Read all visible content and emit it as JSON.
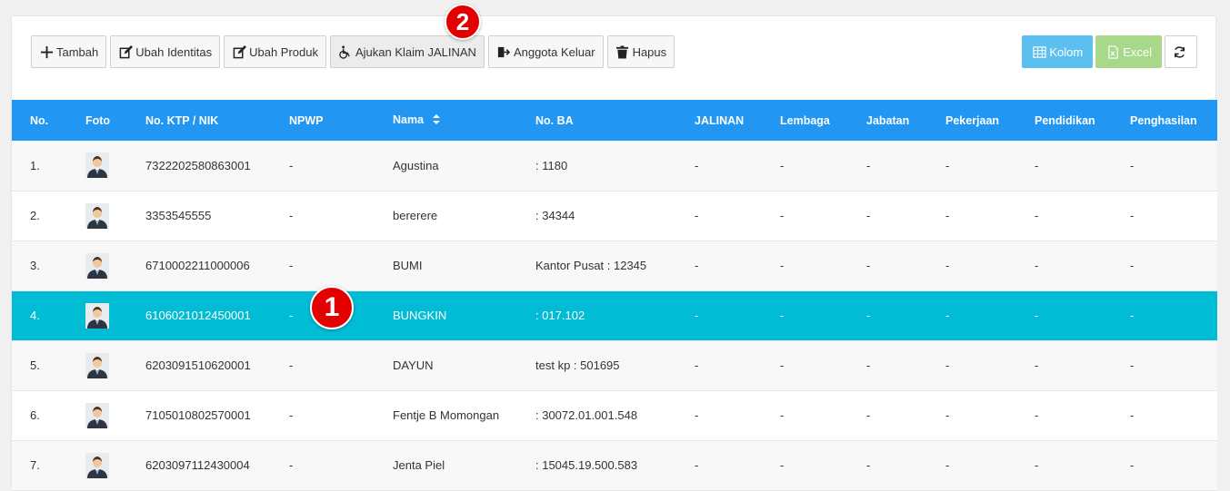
{
  "toolbar": {
    "buttons": [
      {
        "label": "Tambah",
        "icon": "plus-icon"
      },
      {
        "label": "Ubah Identitas",
        "icon": "edit-icon"
      },
      {
        "label": "Ubah Produk",
        "icon": "edit-icon"
      },
      {
        "label": "Ajukan Klaim JALINAN",
        "icon": "wheelchair-icon"
      },
      {
        "label": "Anggota Keluar",
        "icon": "sign-out-icon"
      },
      {
        "label": "Hapus",
        "icon": "trash-icon"
      }
    ],
    "right": {
      "kolom_label": "Kolom",
      "excel_label": "Excel",
      "refresh_icon": "refresh-icon"
    }
  },
  "table": {
    "headers": [
      "No.",
      "Foto",
      "No. KTP / NIK",
      "NPWP",
      "Nama",
      "No. BA",
      "JALINAN",
      "Lembaga",
      "Jabatan",
      "Pekerjaan",
      "Pendidikan",
      "Penghasilan"
    ],
    "rows": [
      {
        "no": "1.",
        "ktp": "7322202580863001",
        "npwp": "-",
        "nama": "Agustina",
        "ba": ": 1180",
        "jalinan": "-",
        "lembaga": "-",
        "jabatan": "-",
        "pekerjaan": "-",
        "pendidikan": "-",
        "penghasilan": "-"
      },
      {
        "no": "2.",
        "ktp": "3353545555",
        "npwp": "-",
        "nama": "bererere",
        "ba": ": 34344",
        "jalinan": "-",
        "lembaga": "-",
        "jabatan": "-",
        "pekerjaan": "-",
        "pendidikan": "-",
        "penghasilan": "-"
      },
      {
        "no": "3.",
        "ktp": "6710002211000006",
        "npwp": "-",
        "nama": "BUMI",
        "ba": "Kantor Pusat : 12345",
        "jalinan": "-",
        "lembaga": "-",
        "jabatan": "-",
        "pekerjaan": "-",
        "pendidikan": "-",
        "penghasilan": "-"
      },
      {
        "no": "4.",
        "ktp": "6106021012450001",
        "npwp": "-",
        "nama": "BUNGKIN",
        "ba": ": 017.102",
        "jalinan": "-",
        "lembaga": "-",
        "jabatan": "-",
        "pekerjaan": "-",
        "pendidikan": "-",
        "penghasilan": "-"
      },
      {
        "no": "5.",
        "ktp": "6203091510620001",
        "npwp": "-",
        "nama": "DAYUN",
        "ba": "test kp : 501695",
        "jalinan": "-",
        "lembaga": "-",
        "jabatan": "-",
        "pekerjaan": "-",
        "pendidikan": "-",
        "penghasilan": "-"
      },
      {
        "no": "6.",
        "ktp": "7105010802570001",
        "npwp": "-",
        "nama": "Fentje B Momongan",
        "ba": ": 30072.01.001.548",
        "jalinan": "-",
        "lembaga": "-",
        "jabatan": "-",
        "pekerjaan": "-",
        "pendidikan": "-",
        "penghasilan": "-"
      },
      {
        "no": "7.",
        "ktp": "6203097112430004",
        "npwp": "-",
        "nama": "Jenta Piel",
        "ba": ": 15045.19.500.583",
        "jalinan": "-",
        "lembaga": "-",
        "jabatan": "-",
        "pekerjaan": "-",
        "pendidikan": "-",
        "penghasilan": "-"
      }
    ],
    "selected_row": 4
  },
  "annotations": {
    "badge_1": "1",
    "badge_2": "2"
  },
  "colors": {
    "header_bg": "#2196f3",
    "selected_row_bg": "#00bcd4",
    "kolom_bg": "#5bc0f0",
    "excel_bg": "#a8d88a",
    "badge_bg": "#e30000"
  }
}
